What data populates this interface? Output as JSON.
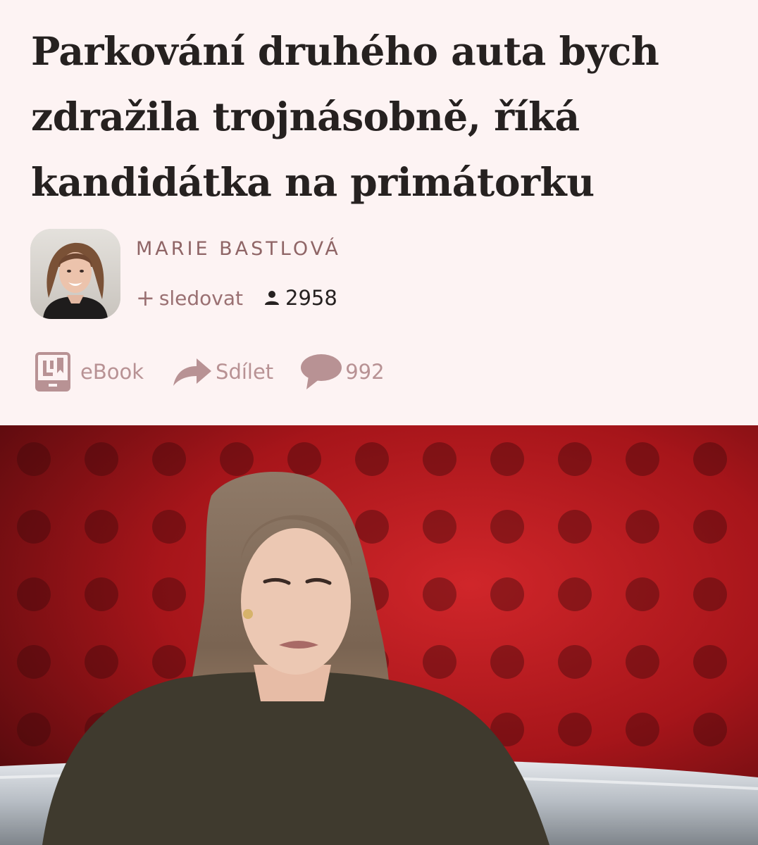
{
  "article": {
    "headline": "Parkování druhého auta bych zdražila trojnásobně, říká kandidátka na primátorku"
  },
  "author": {
    "name": "MARIE BASTLOVÁ",
    "follow_label": "sledovat",
    "followers": "2958"
  },
  "actions": {
    "ebook_label": "eBook",
    "share_label": "Sdílet",
    "comments_count": "992"
  },
  "icons": {
    "follow": "plus-icon",
    "followers": "person-icon",
    "ebook": "ebook-icon",
    "share": "share-arrow-icon",
    "comments": "comment-bubble-icon"
  },
  "colors": {
    "background": "#fdf3f3",
    "headline": "#262120",
    "author_accent": "#8f6566",
    "action_accent": "#b89294",
    "photo_backdrop": "#c4181d"
  }
}
